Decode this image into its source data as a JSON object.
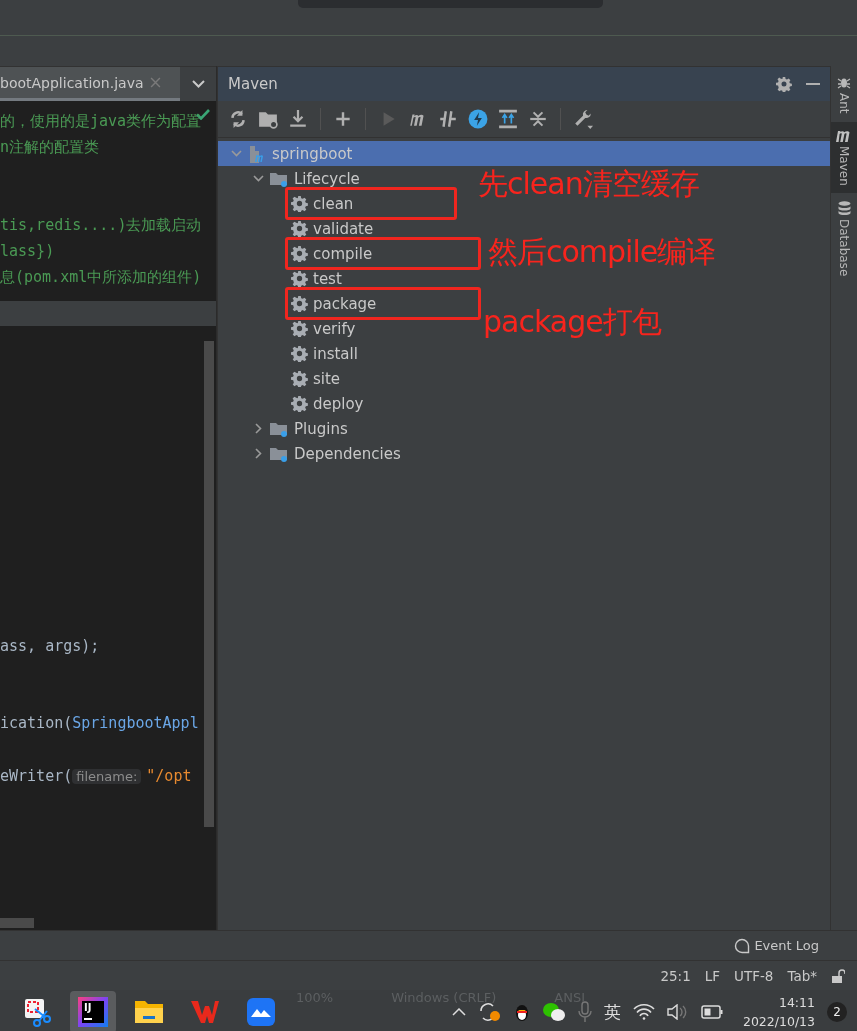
{
  "editor_tab": {
    "label": "bootApplication.java",
    "selected": true
  },
  "editor": {
    "top_lines": [
      {
        "segments": [
          {
            "kind": "comment",
            "text": "的，使用的是java类作为配置"
          }
        ]
      },
      {
        "segments": [
          {
            "kind": "comment",
            "text": "n注解的配置类"
          }
        ]
      },
      {
        "segments": [
          {
            "kind": "comment",
            "text": "tis,redis....)去加载启动"
          }
        ]
      },
      {
        "segments": [
          {
            "kind": "comment",
            "text": "lass})"
          }
        ]
      },
      {
        "segments": [
          {
            "kind": "comment",
            "text": "息(pom.xml中所添加的组件)"
          }
        ]
      }
    ],
    "bottom_lines": [
      {
        "segments": [
          {
            "kind": "plain",
            "text": "ass, args);"
          }
        ]
      },
      {
        "segments": [
          {
            "kind": "plain",
            "text": "ication("
          },
          {
            "kind": "type",
            "text": "SpringbootAppl"
          }
        ]
      },
      {
        "segments": [
          {
            "kind": "plain",
            "text": "eWriter("
          },
          {
            "kind": "hint",
            "text": "filename:"
          },
          {
            "kind": "string",
            "text": "\"/opt"
          }
        ]
      }
    ]
  },
  "maven": {
    "title": "Maven",
    "tree": [
      {
        "label": "springboot",
        "kind": "project",
        "selected": true,
        "expanded": true,
        "children": [
          {
            "label": "Lifecycle",
            "kind": "folder",
            "selected": false,
            "expanded": true,
            "children": [
              {
                "label": "clean",
                "kind": "goal",
                "selected": false,
                "highlighted": true
              },
              {
                "label": "validate",
                "kind": "goal",
                "selected": false,
                "highlighted": false
              },
              {
                "label": "compile",
                "kind": "goal",
                "selected": false,
                "highlighted": true
              },
              {
                "label": "test",
                "kind": "goal",
                "selected": false,
                "highlighted": false
              },
              {
                "label": "package",
                "kind": "goal",
                "selected": false,
                "highlighted": true
              },
              {
                "label": "verify",
                "kind": "goal",
                "selected": false,
                "highlighted": false
              },
              {
                "label": "install",
                "kind": "goal",
                "selected": false,
                "highlighted": false
              },
              {
                "label": "site",
                "kind": "goal",
                "selected": false,
                "highlighted": false
              },
              {
                "label": "deploy",
                "kind": "goal",
                "selected": false,
                "highlighted": false
              }
            ]
          },
          {
            "label": "Plugins",
            "kind": "folder",
            "selected": false,
            "expanded": false
          },
          {
            "label": "Dependencies",
            "kind": "folder",
            "selected": false,
            "expanded": false
          }
        ]
      }
    ],
    "annotations": [
      {
        "text": "先clean清空缓存"
      },
      {
        "text": "然后compile编译"
      },
      {
        "text": "package打包"
      }
    ]
  },
  "side_tabs": [
    {
      "label": "Ant",
      "kind": "ant",
      "selected": false
    },
    {
      "label": "Maven",
      "kind": "maven",
      "selected": true
    },
    {
      "label": "Database",
      "kind": "database",
      "selected": false
    }
  ],
  "event_log": "Event Log",
  "status_bar": [
    "25:1",
    "LF",
    "UTF-8",
    "Tab*"
  ],
  "taskbar": {
    "apps": [
      {
        "kind": "snip",
        "selected": false
      },
      {
        "kind": "idea",
        "label": "IJ",
        "selected": true
      },
      {
        "kind": "folder",
        "selected": false
      },
      {
        "kind": "office",
        "selected": false
      },
      {
        "kind": "cloud",
        "selected": false
      }
    ],
    "ghost_texts": [
      "100%",
      "Windows (CRLF)",
      "ANSI"
    ],
    "input_method": "英",
    "time": "14:11",
    "date": "2022/10/13",
    "notifications": "2"
  }
}
